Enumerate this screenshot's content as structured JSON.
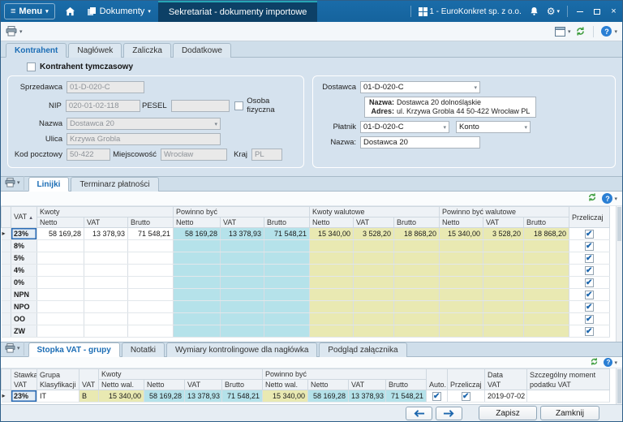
{
  "colors": {
    "titlebar_blue": "#15639d",
    "active_tab_navy": "#0d4066",
    "cyan_cells": "#b5e2ea",
    "yellow_cells": "#e9e9b2"
  },
  "titlebar": {
    "menu": "Menu",
    "documents": "Dokumenty",
    "active_document": "Sekretariat - dokumenty importowe",
    "company": "1 - EuroKonkret sp. z o.o."
  },
  "form": {
    "tabs": [
      {
        "label": "Kontrahent",
        "active": true
      },
      {
        "label": "Nagłówek",
        "active": false
      },
      {
        "label": "Zaliczka",
        "active": false
      },
      {
        "label": "Dodatkowe",
        "active": false
      }
    ],
    "temp_contractor": {
      "label": "Kontrahent tymczasowy",
      "checked": false
    },
    "left": {
      "sprzedawca": {
        "label": "Sprzedawca",
        "value": "01-D-020-C"
      },
      "nip": {
        "label": "NIP",
        "value": "020-01-02-118"
      },
      "pesel": {
        "label": "PESEL",
        "value": ""
      },
      "osoba_fizyczna": {
        "label": "Osoba fizyczna",
        "checked": false
      },
      "nazwa": {
        "label": "Nazwa",
        "value": "Dostawca 20"
      },
      "ulica": {
        "label": "Ulica",
        "value": "Krzywa Grobla"
      },
      "kod_pocztowy": {
        "label": "Kod pocztowy",
        "value": "50-422"
      },
      "miejscowosc": {
        "label": "Miejscowość",
        "value": "Wrocław"
      },
      "kraj": {
        "label": "Kraj",
        "value": "PL"
      }
    },
    "right": {
      "dostawca": {
        "label": "Dostawca",
        "value": "01-D-020-C"
      },
      "info": {
        "nazwa_label": "Nazwa:",
        "nazwa": "Dostawca 20 dolnośląskie",
        "adres_label": "Adres:",
        "adres": "ul. Krzywa Grobla 44 50-422 Wrocław PL"
      },
      "platnik": {
        "label": "Płatnik",
        "value": "01-D-020-C"
      },
      "konto": {
        "label": "Konto"
      },
      "nazwa": {
        "label": "Nazwa:",
        "value": "Dostawca 20"
      }
    }
  },
  "lines": {
    "tabs": [
      {
        "label": "Linijki",
        "active": true
      },
      {
        "label": "Terminarz płatności",
        "active": false
      }
    ],
    "head": {
      "vat": "VAT",
      "kwoty": "Kwoty",
      "powinno_byc": "Powinno być",
      "kwoty_walutowe": "Kwoty walutowe",
      "powinno_byc_walutowe": "Powinno być walutowe",
      "przeliczaj": "Przeliczaj",
      "netto": "Netto",
      "vat_sub": "VAT",
      "brutto": "Brutto"
    },
    "rows": [
      {
        "vat": "23%",
        "selected": true,
        "przeliczaj": true,
        "values": [
          "58 169,28",
          "13 378,93",
          "71 548,21",
          "58 169,28",
          "13 378,93",
          "71 548,21",
          "15 340,00",
          "3 528,20",
          "18 868,20",
          "15 340,00",
          "3 528,20",
          "18 868,20"
        ]
      },
      {
        "vat": "8%",
        "selected": false,
        "przeliczaj": true,
        "values": [
          "",
          "",
          "",
          "",
          "",
          "",
          "",
          "",
          "",
          "",
          "",
          ""
        ]
      },
      {
        "vat": "5%",
        "selected": false,
        "przeliczaj": true,
        "values": [
          "",
          "",
          "",
          "",
          "",
          "",
          "",
          "",
          "",
          "",
          "",
          ""
        ]
      },
      {
        "vat": "4%",
        "selected": false,
        "przeliczaj": true,
        "values": [
          "",
          "",
          "",
          "",
          "",
          "",
          "",
          "",
          "",
          "",
          "",
          ""
        ]
      },
      {
        "vat": "0%",
        "selected": false,
        "przeliczaj": true,
        "values": [
          "",
          "",
          "",
          "",
          "",
          "",
          "",
          "",
          "",
          "",
          "",
          ""
        ]
      },
      {
        "vat": "NPN",
        "selected": false,
        "przeliczaj": true,
        "values": [
          "",
          "",
          "",
          "",
          "",
          "",
          "",
          "",
          "",
          "",
          "",
          ""
        ]
      },
      {
        "vat": "NPO",
        "selected": false,
        "przeliczaj": true,
        "values": [
          "",
          "",
          "",
          "",
          "",
          "",
          "",
          "",
          "",
          "",
          "",
          ""
        ]
      },
      {
        "vat": "OO",
        "selected": false,
        "przeliczaj": true,
        "values": [
          "",
          "",
          "",
          "",
          "",
          "",
          "",
          "",
          "",
          "",
          "",
          ""
        ]
      },
      {
        "vat": "ZW",
        "selected": false,
        "przeliczaj": true,
        "values": [
          "",
          "",
          "",
          "",
          "",
          "",
          "",
          "",
          "",
          "",
          "",
          ""
        ]
      }
    ]
  },
  "footer": {
    "tabs": [
      {
        "label": "Stopka VAT - grupy",
        "active": true
      },
      {
        "label": "Notatki",
        "active": false
      },
      {
        "label": "Wymiary kontrolingowe dla nagłówka",
        "active": false
      },
      {
        "label": "Podgląd załącznika",
        "active": false
      }
    ],
    "head1": {
      "stawka": "Stawka",
      "grupa": "Grupa",
      "vat": "VAT",
      "kwoty": "Kwoty",
      "powinno_byc": "Powinno być",
      "auto": "Auto.",
      "przeliczaj": "Przeliczaj",
      "data": "Data",
      "szczegolny": "Szczególny moment"
    },
    "head2": {
      "stawka": "VAT",
      "grupa": "Klasyfikacji",
      "netto_wal": "Netto wal.",
      "netto": "Netto",
      "vat": "VAT",
      "brutto": "Brutto",
      "data": "VAT",
      "szczegolny": "podatku VAT"
    },
    "rows": [
      {
        "stawka": "23%",
        "grupa": "IT",
        "vat": "B",
        "selected": true,
        "values": [
          "15 340,00",
          "58 169,28",
          "13 378,93",
          "71 548,21",
          "15 340,00",
          "58 169,28",
          "13 378,93",
          "71 548,21"
        ],
        "auto": true,
        "przeliczaj": true,
        "data_vat": "2019-07-02",
        "szczegolny": ""
      }
    ]
  },
  "buttons": {
    "save": "Zapisz",
    "close": "Zamknij"
  }
}
